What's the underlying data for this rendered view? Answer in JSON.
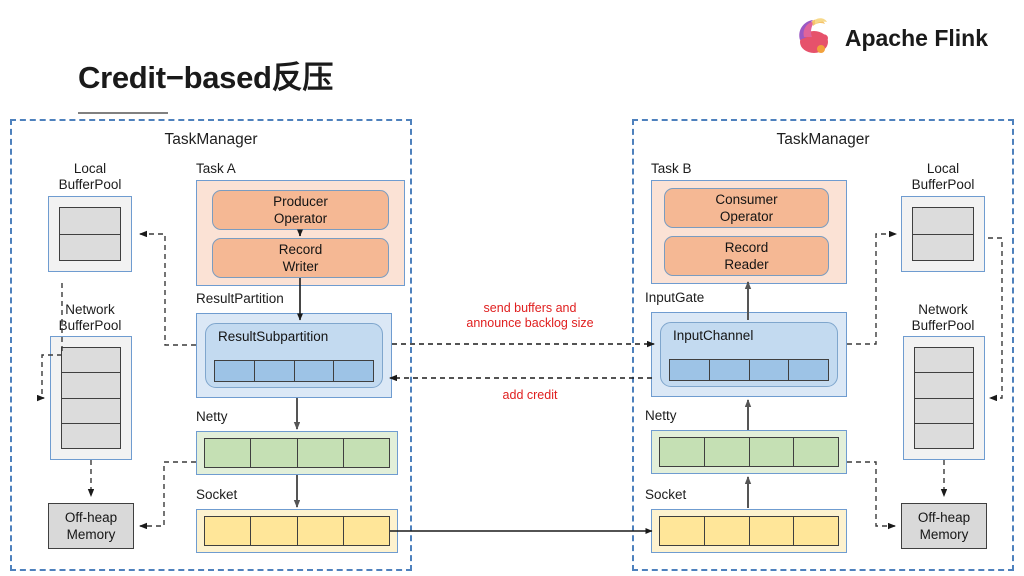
{
  "header": {
    "title": "Credit−based反压",
    "brand_name": "Apache Flink",
    "brand_icon": "flink-squirrel-logo"
  },
  "colors": {
    "dashed_border": "#4e81bd",
    "task_fill": "#fbe2d5",
    "operator_fill": "#f5b894",
    "partition_fill": "#dbe8f6",
    "subpartition_fill": "#c3daf0",
    "buffer_blue": "#9dc3e6",
    "netty_green": "#c5e0b4",
    "socket_yellow": "#ffe699",
    "pool_gray": "#dcdcdc",
    "offheap_gray": "#d9d9d9",
    "annotation_red": "#e02020"
  },
  "left_taskmanager": {
    "title": "TaskManager",
    "local_buffer_pool": {
      "label_line1": "Local",
      "label_line2": "BufferPool",
      "cells": 2
    },
    "network_buffer_pool": {
      "label_line1": "Network",
      "label_line2": "BufferPool",
      "cells": 4
    },
    "off_heap_memory": {
      "line1": "Off-heap",
      "line2": "Memory"
    },
    "task": {
      "label": "Task A",
      "operators": [
        {
          "line1": "Producer",
          "line2": "Operator"
        },
        {
          "line1": "Record",
          "line2": "Writer"
        }
      ]
    },
    "result_partition": {
      "label": "ResultPartition",
      "subpartition_label": "ResultSubpartition",
      "buffer_cells": 4
    },
    "netty": {
      "label": "Netty",
      "buffer_cells": 4
    },
    "socket": {
      "label": "Socket",
      "buffer_cells": 4
    }
  },
  "right_taskmanager": {
    "title": "TaskManager",
    "local_buffer_pool": {
      "label_line1": "Local",
      "label_line2": "BufferPool",
      "cells": 2
    },
    "network_buffer_pool": {
      "label_line1": "Network",
      "label_line2": "BufferPool",
      "cells": 4
    },
    "off_heap_memory": {
      "line1": "Off-heap",
      "line2": "Memory"
    },
    "task": {
      "label": "Task B",
      "operators": [
        {
          "line1": "Consumer",
          "line2": "Operator"
        },
        {
          "line1": "Record",
          "line2": "Reader"
        }
      ]
    },
    "input_gate": {
      "label": "InputGate",
      "channel_label": "InputChannel",
      "buffer_cells": 4
    },
    "netty": {
      "label": "Netty",
      "buffer_cells": 4
    },
    "socket": {
      "label": "Socket",
      "buffer_cells": 4
    }
  },
  "annotations": {
    "send_buffers_line1": "send buffers and",
    "send_buffers_line2": "announce backlog size",
    "add_credit": "add credit"
  }
}
